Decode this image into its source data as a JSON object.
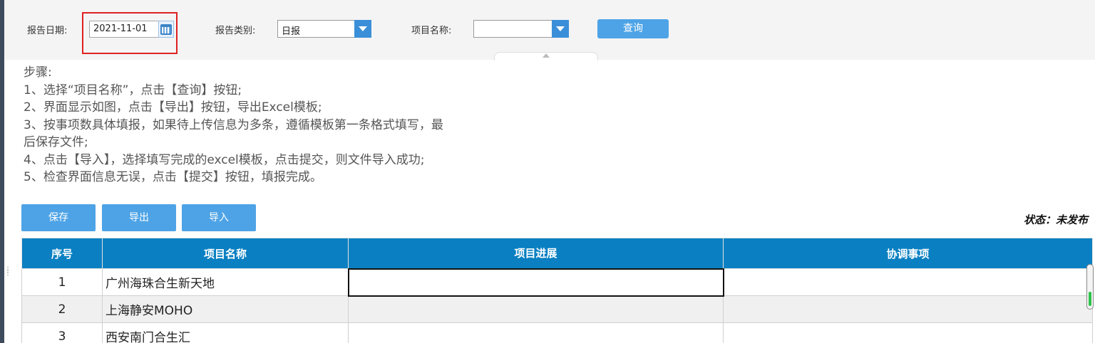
{
  "filters": {
    "date_label": "报告日期:",
    "date_value": "2021-11-01",
    "type_label": "报告类别:",
    "type_value": "日报",
    "project_label": "项目名称:",
    "project_value": "",
    "query_button": "查询"
  },
  "steps": [
    "步骤:",
    "1、选择“项目名称”，点击【查询】按钮;",
    "2、界面显示如图，点击【导出】按钮，导出Excel模板;",
    "3、按事项数具体填报，如果待上传信息为多条，遵循模板第一条格式填写，最",
    "后保存文件;",
    "4、点击【导入】，选择填写完成的excel模板，点击提交，则文件导入成功;",
    "5、检查界面信息无误，点击【提交】按钮，填报完成。"
  ],
  "actions": {
    "save": "保存",
    "export": "导出",
    "import": "导入"
  },
  "status": "状态：未发布",
  "table": {
    "columns": [
      "序号",
      "项目名称",
      "项目进展",
      "协调事项"
    ],
    "rows": [
      {
        "no": "1",
        "name": "广州海珠合生新天地",
        "progress": "",
        "coordination": ""
      },
      {
        "no": "2",
        "name": "上海静安MOHO",
        "progress": "",
        "coordination": ""
      },
      {
        "no": "3",
        "name": "西安南门合生汇",
        "progress": "",
        "coordination": ""
      }
    ]
  },
  "colors": {
    "header_blue": "#0a80c2",
    "button_blue": "#4da3e6",
    "highlight_red": "#e02020"
  }
}
